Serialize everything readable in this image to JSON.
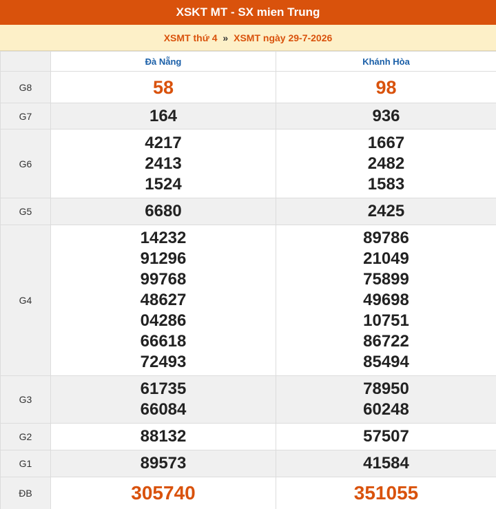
{
  "header": {
    "title": "XSKT MT - SX mien Trung",
    "sub_link_1": "XSMT thứ 4",
    "separator": "»",
    "sub_link_2": "XSMT ngày 29-7-2026"
  },
  "columns": [
    "Đà Nẵng",
    "Khánh Hòa"
  ],
  "rows": {
    "g8": {
      "label": "G8",
      "c1": [
        "58"
      ],
      "c2": [
        "98"
      ]
    },
    "g7": {
      "label": "G7",
      "c1": [
        "164"
      ],
      "c2": [
        "936"
      ]
    },
    "g6": {
      "label": "G6",
      "c1": [
        "4217",
        "2413",
        "1524"
      ],
      "c2": [
        "1667",
        "2482",
        "1583"
      ]
    },
    "g5": {
      "label": "G5",
      "c1": [
        "6680"
      ],
      "c2": [
        "2425"
      ]
    },
    "g4": {
      "label": "G4",
      "c1": [
        "14232",
        "91296",
        "99768",
        "48627",
        "04286",
        "66618",
        "72493"
      ],
      "c2": [
        "89786",
        "21049",
        "75899",
        "49698",
        "10751",
        "86722",
        "85494"
      ]
    },
    "g3": {
      "label": "G3",
      "c1": [
        "61735",
        "66084"
      ],
      "c2": [
        "78950",
        "60248"
      ]
    },
    "g2": {
      "label": "G2",
      "c1": [
        "88132"
      ],
      "c2": [
        "57507"
      ]
    },
    "g1": {
      "label": "G1",
      "c1": [
        "89573"
      ],
      "c2": [
        "41584"
      ]
    },
    "db": {
      "label": "ĐB",
      "c1": [
        "305740"
      ],
      "c2": [
        "351055"
      ]
    }
  },
  "colors": {
    "accent": "#d9520c",
    "header_bg": "#fdf0c8",
    "column_header": "#1a5fa8"
  }
}
